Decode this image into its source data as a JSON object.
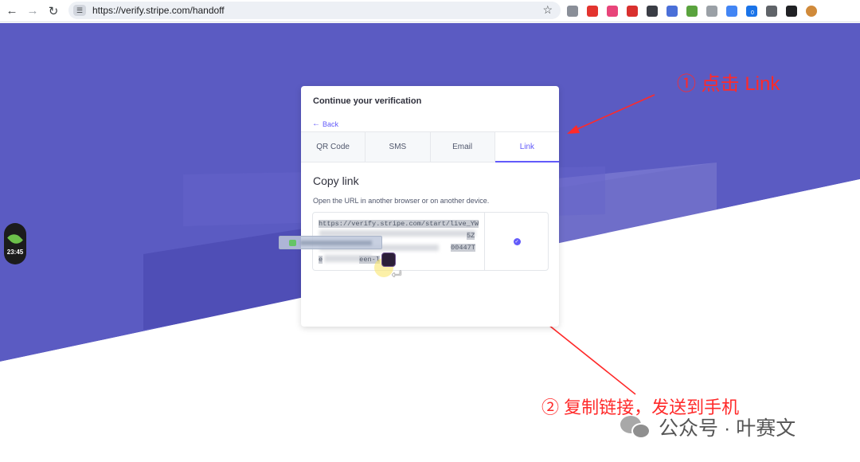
{
  "browser": {
    "url": "https://verify.stripe.com/handoff",
    "extensions": [
      {
        "name": "image-ext-icon",
        "color": "#8a8f98"
      },
      {
        "name": "abp-icon",
        "color": "#e3342f"
      },
      {
        "name": "pink-ext-icon",
        "color": "#e8457a"
      },
      {
        "name": "red-ext-icon",
        "color": "#d9302e"
      },
      {
        "name": "dark-ext-icon",
        "color": "#3a3d45"
      },
      {
        "name": "v-ext-icon",
        "color": "#4a6fd8"
      },
      {
        "name": "frog-ext-icon",
        "color": "#5aa33e"
      },
      {
        "name": "camera-ext-icon",
        "color": "#9aa0a6"
      },
      {
        "name": "blue-ext-icon",
        "color": "#4285f4"
      },
      {
        "name": "counter-ext-icon",
        "color": "#1a73e8"
      },
      {
        "name": "puzzle-icon",
        "color": "#5f6368"
      },
      {
        "name": "sidepanel-icon",
        "color": "#202124"
      },
      {
        "name": "avatar-icon",
        "color": "#d08a3a"
      }
    ],
    "ext_badge": "0"
  },
  "timer": {
    "time": "23:45"
  },
  "verification": {
    "title": "Continue your verification",
    "back_label": "Back",
    "tabs": [
      {
        "label": "QR Code",
        "active": false
      },
      {
        "label": "SMS",
        "active": false
      },
      {
        "label": "Email",
        "active": false
      },
      {
        "label": "Link",
        "active": true
      }
    ],
    "section_title": "Copy link",
    "section_desc": "Open the URL in another browser or on another device.",
    "url_line1": "https://verify.stripe.com/start/live_YW",
    "url_line2_end": "5Z",
    "url_line3_end": "00447T",
    "url_line4_start": "e",
    "url_line4_mid": "een-l"
  },
  "annotations": {
    "step1": "① 点击 Link",
    "step2": "② 复制链接，发送到手机",
    "color": "#ff2a2a"
  },
  "watermark": {
    "text": "公众号 · 叶赛文"
  },
  "colors": {
    "stripe_purple": "#5b5bc2",
    "accent": "#625afa"
  }
}
